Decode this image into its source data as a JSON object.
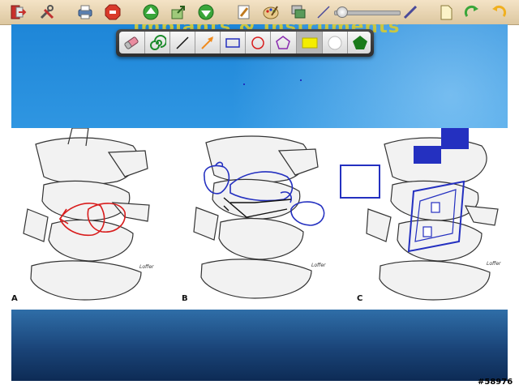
{
  "slide": {
    "title": "Implants & Instruments"
  },
  "figure": {
    "panels": [
      {
        "label": "A",
        "credit": "Loffer"
      },
      {
        "label": "B",
        "credit": "Loffer"
      },
      {
        "label": "C",
        "credit": "Loffer"
      }
    ]
  },
  "toolbar": {
    "icons": [
      "exit-icon",
      "tools-icon",
      "print-icon",
      "stop-icon",
      "up-arrow-icon",
      "export-icon",
      "down-arrow-icon",
      "pen-icon",
      "palette-icon",
      "layers-icon",
      "thin-line-icon",
      "thick-line-icon",
      "blank-page-icon",
      "redo-icon",
      "undo-icon"
    ],
    "stroke_width_fraction": 0.05
  },
  "palette": {
    "tools": [
      "eraser",
      "spiral",
      "line",
      "arrow",
      "rectangle",
      "circle",
      "polygon",
      "highlight",
      "white-fill",
      "green-fill"
    ],
    "selected": "highlight",
    "colors": {
      "red": "#d81c1c",
      "blue": "#2430c0",
      "orange": "#f08a1c",
      "yellow": "#f4ee00",
      "green": "#1a7a1a"
    }
  },
  "watermark": "#58976"
}
